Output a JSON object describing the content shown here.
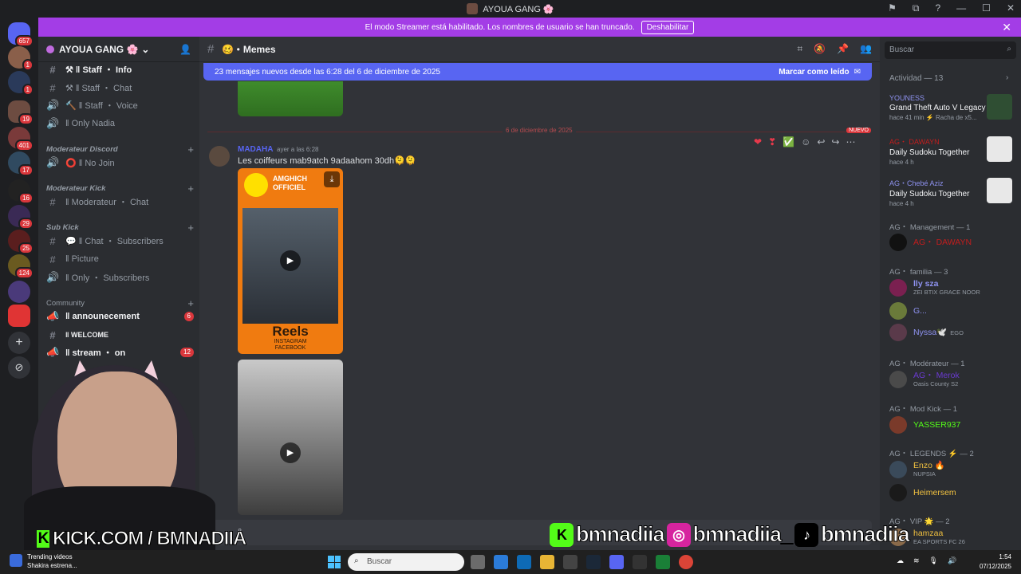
{
  "window": {
    "title": "AYOUA GANG 🌸",
    "buttons": [
      "⚑",
      "⧉",
      "?",
      "—",
      "☐",
      "✕"
    ]
  },
  "streamer_banner": {
    "text": "El modo Streamer está habilitado. Los nombres de usuario se han truncado.",
    "button": "Deshabilitar",
    "close": "✕"
  },
  "servers": [
    {
      "badge": "657"
    },
    {
      "badge": "1"
    },
    {
      "badge": "1"
    },
    {
      "badge": "19"
    },
    {
      "badge": "401"
    },
    {
      "badge": "17"
    },
    {
      "badge": "16"
    },
    {
      "badge": "29"
    },
    {
      "badge": "25"
    },
    {
      "badge": "124"
    },
    {
      "badge": ""
    },
    {
      "badge": ""
    }
  ],
  "sidebar": {
    "guild_name": "AYOUA GANG 🌸",
    "channels": [
      {
        "label": "⚒ ‖ Staff ・ Info",
        "icon": "#"
      },
      {
        "label": "⚒ ‖ Staff ・ Chat",
        "icon": "#"
      },
      {
        "label": "🔨 ‖ Staff ・ Voice",
        "icon": "🔊"
      },
      {
        "label": "‖ Only Nadia",
        "icon": "🔊"
      },
      {
        "label": "⭕ ‖ No Join",
        "icon": "🔊"
      },
      {
        "label": "‖ Moderateur ・ Chat",
        "icon": "#"
      },
      {
        "label": "💬 ‖ Chat ・ Subscribers",
        "icon": "#"
      },
      {
        "label": "‖ Picture",
        "icon": "#"
      },
      {
        "label": "‖ Only ・ Subscribers",
        "icon": "🔊"
      },
      {
        "label": "‖ announecement",
        "icon": "📣",
        "badge": "6"
      },
      {
        "label": "‖ WELCOME",
        "icon": "#"
      },
      {
        "label": "‖ stream ・ on",
        "icon": "📣",
        "badge": "12"
      }
    ],
    "categories": [
      "Moderateur Discord",
      "Moderateur Kick",
      "Sub Kick",
      "Community"
    ]
  },
  "channel": {
    "name": "Memes",
    "new_messages": "23 mensajes nuevos desde las 6:28 del 6 de diciembre de 2025",
    "mark_read": "Marcar como leído",
    "date_divider": "6 de diciembre de 2025",
    "new_tag": "NUEVO",
    "message": {
      "author": "MADAHA",
      "time": "ayer a las 6:28",
      "text": "Les coiffeurs mab9atch 9adaahom 30dh🫠🫠",
      "video1": {
        "title": "AMGHICH\nOFFICIEL",
        "reels": "Reels",
        "sub": "INSTAGRAM\nFACEBOOK"
      }
    }
  },
  "members": {
    "search_placeholder": "Buscar",
    "activity_header": "Actividad — 13",
    "activities": [
      {
        "name": "YOUNESS",
        "title": "Grand Theft Auto V Legacy",
        "meta": "hace 41 min  ⚡ Racha de x5..."
      },
      {
        "name": "AG・ DAWAYN",
        "title": "Daily Sudoku Together",
        "meta": "hace 4 h"
      },
      {
        "name": "AG・Chebé Aziz",
        "title": "Daily Sudoku Together",
        "meta": "hace 4 h"
      }
    ],
    "groups": [
      {
        "label": "AG・ Management — 1",
        "members": [
          {
            "name": "AG・ DAWAYN",
            "sub": ""
          }
        ]
      },
      {
        "label": "AG・ familia — 3",
        "members": [
          {
            "name": "lly sza",
            "sub": "ZEI BTIX GRACE NOOR"
          },
          {
            "name": "G...",
            "sub": ""
          },
          {
            "name": "Nyssa🕊️",
            "sub": "EGO"
          }
        ]
      },
      {
        "label": "AG・ Modérateur — 1",
        "members": [
          {
            "name": "AG・ Merok",
            "sub": "Oasis County S2"
          }
        ]
      },
      {
        "label": "AG・ Mod Kick — 1",
        "members": [
          {
            "name": "YASSER937",
            "sub": ""
          }
        ]
      },
      {
        "label": "AG・ LEGENDS ⚡ — 2",
        "members": [
          {
            "name": "Enzo 🔥",
            "sub": "NUPSIA"
          },
          {
            "name": "Heimersem",
            "sub": ""
          }
        ]
      },
      {
        "label": "AG・ VIP 🌟 — 2",
        "members": [
          {
            "name": "hamzaa",
            "sub": "EA SPORTS FC 26"
          }
        ]
      }
    ]
  },
  "overlay": {
    "kick_text": "KICK.COM / BMNADIIA",
    "kick_letter": "K",
    "socials": [
      "bmnadiia",
      "bmnadiia_",
      "bmnadiia"
    ]
  },
  "taskbar": {
    "trending_title": "Trending videos",
    "trending_sub": "Shakira estrena...",
    "search": "Buscar",
    "time": "1:54",
    "date": "07/12/2025"
  },
  "colors": {
    "blurple": "#5865f2",
    "streamer_purple": "#a33de6",
    "red": "#da373c",
    "kick_green": "#53fc18"
  }
}
